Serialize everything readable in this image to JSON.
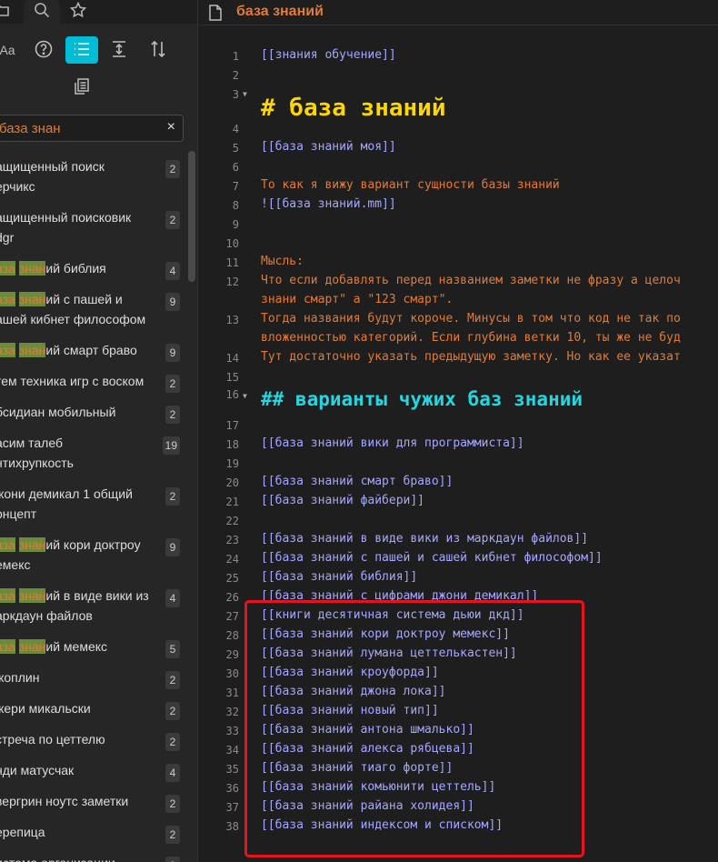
{
  "sidebar": {
    "tabs": [
      {
        "name": "files-tab-icon",
        "icon": "folder-icon"
      },
      {
        "name": "search-tab-icon",
        "icon": "search-icon"
      },
      {
        "name": "starred-tab-icon",
        "icon": "star-icon"
      }
    ],
    "toolbar": {
      "case_label": "Aa",
      "help_label": "?"
    },
    "search": {
      "value": "база знан",
      "clear_glyph": "×"
    },
    "results": [
      {
        "pre": "ащищенный поиск",
        "hl1": "",
        "mid": "",
        "hl2": "",
        "post": "",
        "line2": "ерчикс",
        "count": "2"
      },
      {
        "pre": "ащищенный поисковик",
        "hl1": "",
        "mid": "",
        "hl2": "",
        "post": "",
        "line2": "dgr",
        "count": "2"
      },
      {
        "pre": "",
        "hl1": "аза",
        "mid": " ",
        "hl2": "знан",
        "post": "ий библия",
        "line2": "",
        "count": "4"
      },
      {
        "pre": "",
        "hl1": "аза",
        "mid": " ",
        "hl2": "знан",
        "post": "ий с пашей и",
        "line2": "ашей кибнет философом",
        "count": "9"
      },
      {
        "pre": "",
        "hl1": "аза",
        "mid": " ",
        "hl2": "знан",
        "post": "ий смарт браво",
        "line2": "",
        "count": "9"
      },
      {
        "pre": "тем техника игр с воском",
        "hl1": "",
        "mid": "",
        "hl2": "",
        "post": "",
        "line2": "",
        "count": "2"
      },
      {
        "pre": "бсидиан мобильный",
        "hl1": "",
        "mid": "",
        "hl2": "",
        "post": "",
        "line2": "",
        "count": "2"
      },
      {
        "pre": "асим талеб",
        "hl1": "",
        "mid": "",
        "hl2": "",
        "post": "",
        "line2": "нтихрупкость",
        "count": "19"
      },
      {
        "pre": "жони демикал 1 общий",
        "hl1": "",
        "mid": "",
        "hl2": "",
        "post": "",
        "line2": "онцепт",
        "count": "2"
      },
      {
        "pre": "",
        "hl1": "аза",
        "mid": " ",
        "hl2": "знан",
        "post": "ий кори доктроу",
        "line2": "емекс",
        "count": "9"
      },
      {
        "pre": "",
        "hl1": "аза",
        "mid": " ",
        "hl2": "знан",
        "post": "ий в виде вики из",
        "line2": "аркдаун файлов",
        "count": "4"
      },
      {
        "pre": "",
        "hl1": "аза",
        "mid": " ",
        "hl2": "знан",
        "post": "ий мемекс",
        "line2": "",
        "count": "5"
      },
      {
        "pre": "жоплин",
        "hl1": "",
        "mid": "",
        "hl2": "",
        "post": "",
        "line2": "",
        "count": "2"
      },
      {
        "pre": "жери микальски",
        "hl1": "",
        "mid": "",
        "hl2": "",
        "post": "",
        "line2": "",
        "count": "2"
      },
      {
        "pre": "стреча по цеттелю",
        "hl1": "",
        "mid": "",
        "hl2": "",
        "post": "",
        "line2": "",
        "count": "2"
      },
      {
        "pre": "нди матусчак",
        "hl1": "",
        "mid": "",
        "hl2": "",
        "post": "",
        "line2": "",
        "count": "4"
      },
      {
        "pre": "вергрин ноутс заметки",
        "hl1": "",
        "mid": "",
        "hl2": "",
        "post": "",
        "line2": "",
        "count": "2"
      },
      {
        "pre": "ерепица",
        "hl1": "",
        "mid": "",
        "hl2": "",
        "post": "",
        "line2": "",
        "count": "2"
      },
      {
        "pre": "истема организации",
        "hl1": "",
        "mid": "",
        "hl2": "",
        "post": "",
        "line2": "",
        "count": "2"
      }
    ]
  },
  "editor": {
    "title": "база знаний",
    "lines": [
      {
        "n": "1",
        "kind": "link",
        "text": "[[знания обучение]]"
      },
      {
        "n": "2",
        "kind": "blank",
        "text": ""
      },
      {
        "n": "3",
        "kind": "h1",
        "text": "# база знаний",
        "fold": true
      },
      {
        "n": "4",
        "kind": "blank",
        "text": ""
      },
      {
        "n": "5",
        "kind": "link",
        "text": "[[база знаний моя]]"
      },
      {
        "n": "6",
        "kind": "blank",
        "text": ""
      },
      {
        "n": "7",
        "kind": "text",
        "text": "То как я вижу вариант сущности базы знаний"
      },
      {
        "n": "8",
        "kind": "link",
        "text": "![[база знаний.mm]]"
      },
      {
        "n": "9",
        "kind": "blank",
        "text": ""
      },
      {
        "n": "10",
        "kind": "blank",
        "text": ""
      },
      {
        "n": "11",
        "kind": "text",
        "text": "Мысль:"
      },
      {
        "n": "12",
        "kind": "text",
        "text": "Что если добавлять перед названием заметки не фразу а целоч"
      },
      {
        "n": "",
        "kind": "text",
        "text": "знани смарт\" а \"123 смарт\"."
      },
      {
        "n": "13",
        "kind": "text",
        "text": "Тогда названия будут короче. Минусы в том что код не так по"
      },
      {
        "n": "",
        "kind": "text",
        "text": "вложенностью категорий. Если глубина ветки 10, ты же не буд"
      },
      {
        "n": "14",
        "kind": "text",
        "text": "Тут достаточно указать предыдущую заметку. Но как ее указат"
      },
      {
        "n": "15",
        "kind": "blank",
        "text": ""
      },
      {
        "n": "16",
        "kind": "h2",
        "text": "## варианты чужих баз знаний",
        "fold": true
      },
      {
        "n": "17",
        "kind": "blank",
        "text": ""
      },
      {
        "n": "18",
        "kind": "link",
        "text": "[[база знаний вики для программиста]]"
      },
      {
        "n": "19",
        "kind": "blank",
        "text": ""
      },
      {
        "n": "20",
        "kind": "link",
        "text": "[[база знаний смарт браво]]"
      },
      {
        "n": "21",
        "kind": "link",
        "text": "[[база знаний файбери]]"
      },
      {
        "n": "22",
        "kind": "blank",
        "text": ""
      },
      {
        "n": "23",
        "kind": "link",
        "text": "[[база знаний в виде вики из маркдаун файлов]]"
      },
      {
        "n": "24",
        "kind": "link",
        "text": "[[база знаний с пашей и сашей кибнет философом]]"
      },
      {
        "n": "25",
        "kind": "link",
        "text": "[[база знаний библия]]"
      },
      {
        "n": "26",
        "kind": "link",
        "text": "[[база знаний с цифрами джони демикал]]"
      },
      {
        "n": "27",
        "kind": "link",
        "text": "[[книги десятичная система дьюи дкд]]"
      },
      {
        "n": "28",
        "kind": "link",
        "text": "[[база знаний кори доктроу мемекс]]"
      },
      {
        "n": "29",
        "kind": "link",
        "text": "[[база знаний лумана цеттелькастен]]"
      },
      {
        "n": "30",
        "kind": "link",
        "text": "[[база знаний кроуфорда]]"
      },
      {
        "n": "31",
        "kind": "link",
        "text": "[[база знаний джона лока]]"
      },
      {
        "n": "32",
        "kind": "link",
        "text": "[[база знаний новый тип]]"
      },
      {
        "n": "33",
        "kind": "link",
        "text": "[[база знаний антона шмалько]]"
      },
      {
        "n": "34",
        "kind": "link",
        "text": "[[база знаний алекса рябцева]]"
      },
      {
        "n": "35",
        "kind": "link",
        "text": "[[база знаний тиаго форте]]"
      },
      {
        "n": "36",
        "kind": "link",
        "text": "[[база знаний комьюнити цеттель]]"
      },
      {
        "n": "37",
        "kind": "link",
        "text": "[[база знаний райана холидея]]"
      },
      {
        "n": "38",
        "kind": "link",
        "text": "[[база знаний индексом и списком]]"
      }
    ]
  },
  "colors": {
    "accent": "#00bcd4",
    "title": "#e07b39",
    "link": "#a6a6ff",
    "h1": "#ffd700",
    "h2": "#23d6e0",
    "highlight_border": "#e6131f"
  }
}
